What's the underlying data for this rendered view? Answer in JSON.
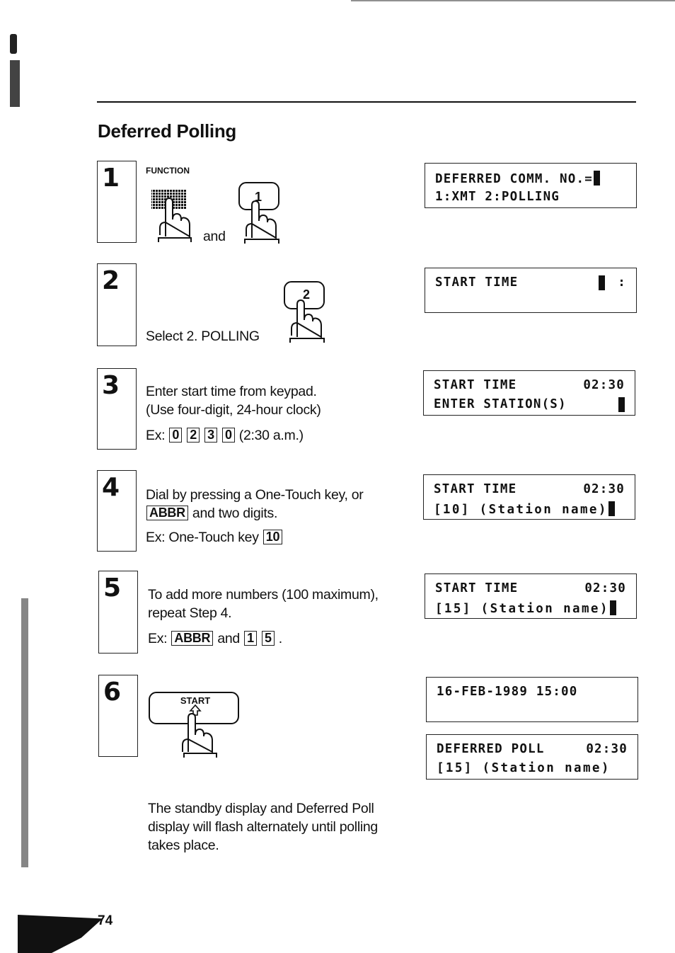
{
  "page": {
    "title": "Deferred Polling",
    "page_number": "74"
  },
  "steps": [
    {
      "number": "1",
      "label_function": "FUNCTION",
      "and": "and",
      "key_1": "1",
      "display": {
        "line1": "DEFERRED COMM. NO.=",
        "line2": "1:XMT 2:POLLING"
      }
    },
    {
      "number": "2",
      "text": "Select 2. POLLING",
      "key_2": "2",
      "display": {
        "line1": "START TIME",
        "line1_right": ":",
        "line2": ""
      }
    },
    {
      "number": "3",
      "line1": "Enter start time from keypad.",
      "line2": "(Use four-digit, 24-hour clock)",
      "ex_prefix": "Ex:",
      "keys": [
        "0",
        "2",
        "3",
        "0"
      ],
      "ex_suffix": "(2:30 a.m.)",
      "display": {
        "line1": "START TIME",
        "line1_right": "02:30",
        "line2": "ENTER STATION(S)"
      }
    },
    {
      "number": "4",
      "line1": "Dial by pressing a One-Touch key, or",
      "abbr_key": "ABBR",
      "line2_rest": "and two digits.",
      "ex_text": "Ex: One-Touch key",
      "ex_key": "10",
      "display": {
        "line1": "START TIME",
        "line1_right": "02:30",
        "line2": "[10] (Station name)"
      }
    },
    {
      "number": "5",
      "line1": "To add more numbers (100 maximum),",
      "line2": "repeat Step 4.",
      "ex_prefix": "Ex:",
      "abbr_key": "ABBR",
      "and": "and",
      "keys": [
        "1",
        "5"
      ],
      "ex_suffix": ".",
      "display": {
        "line1": "START TIME",
        "line1_right": "02:30",
        "line2": "[15] (Station name)"
      }
    },
    {
      "number": "6",
      "start_key": "START",
      "display_standby": {
        "line1": "16-FEB-1989 15:00",
        "line2": ""
      },
      "display_poll": {
        "line1": "DEFERRED POLL",
        "line1_right": "02:30",
        "line2": "[15] (Station name)"
      },
      "note": [
        "The standby display and Deferred Poll",
        "display will flash alternately until polling",
        "takes place."
      ]
    }
  ]
}
